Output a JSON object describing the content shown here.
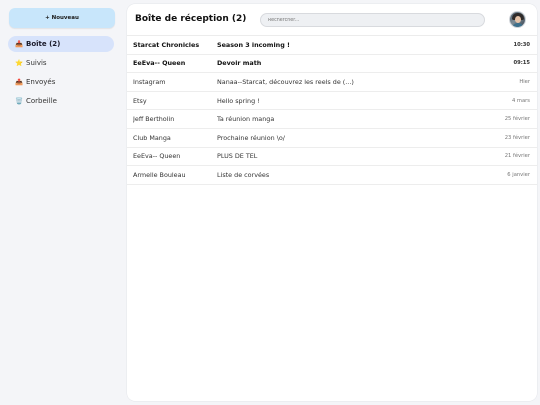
{
  "sidebar": {
    "compose_label": "+ Nouveau",
    "items": [
      {
        "icon": "📥",
        "icon_name": "inbox-icon",
        "label": "Boîte (2)",
        "active": true
      },
      {
        "icon": "⭐",
        "icon_name": "star-icon",
        "label": "Suivis",
        "active": false
      },
      {
        "icon": "📤",
        "icon_name": "outbox-icon",
        "label": "Envoyés",
        "active": false
      },
      {
        "icon": "🗑️",
        "icon_name": "trash-icon",
        "label": "Corbeille",
        "active": false
      }
    ]
  },
  "header": {
    "title": "Boîte de réception (2)",
    "search_placeholder": "Rechercher..."
  },
  "emails": [
    {
      "sender": "Starcat Chronicles",
      "subject": "Season 3 incoming !",
      "date": "10:30",
      "unread": true
    },
    {
      "sender": "EeEva-- Queen",
      "subject": "Devoir math",
      "date": "09:15",
      "unread": true
    },
    {
      "sender": "Instagram",
      "subject": "Nanaa--Starcat, découvrez les reels de (...)",
      "date": "Hier",
      "unread": false
    },
    {
      "sender": "Etsy",
      "subject": "Hello spring !",
      "date": "4 mars",
      "unread": false
    },
    {
      "sender": "Jeff Bertholin",
      "subject": "Ta réunion manga",
      "date": "25 février",
      "unread": false
    },
    {
      "sender": "Club Manga",
      "subject": "Prochaine réunion \\o/",
      "date": "23 février",
      "unread": false
    },
    {
      "sender": "EeEva-- Queen",
      "subject": "PLUS DE TEL",
      "date": "21 février",
      "unread": false
    },
    {
      "sender": "Armelle Bouleau",
      "subject": "Liste de corvées",
      "date": "6 janvier",
      "unread": false
    }
  ],
  "colors": {
    "compose_bg": "#c8e6fb",
    "active_nav_bg": "#d7e3fb",
    "page_bg": "#f4f5f8"
  }
}
